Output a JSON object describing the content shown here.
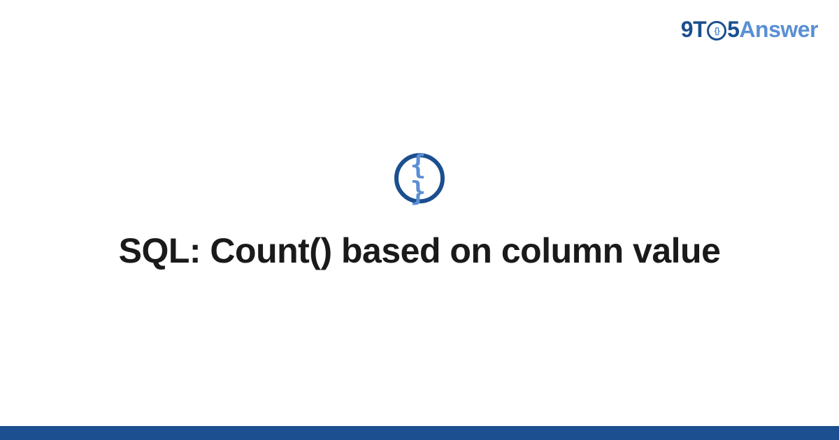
{
  "logo": {
    "part1": "9T",
    "circle_inner": "{}",
    "part2": "5",
    "part3": "Answer"
  },
  "icon": {
    "braces": "{ }"
  },
  "main": {
    "title": "SQL: Count() based on column value"
  },
  "colors": {
    "primary": "#1b4f8f",
    "secondary": "#5a8fd4",
    "text": "#1a1a1a"
  }
}
